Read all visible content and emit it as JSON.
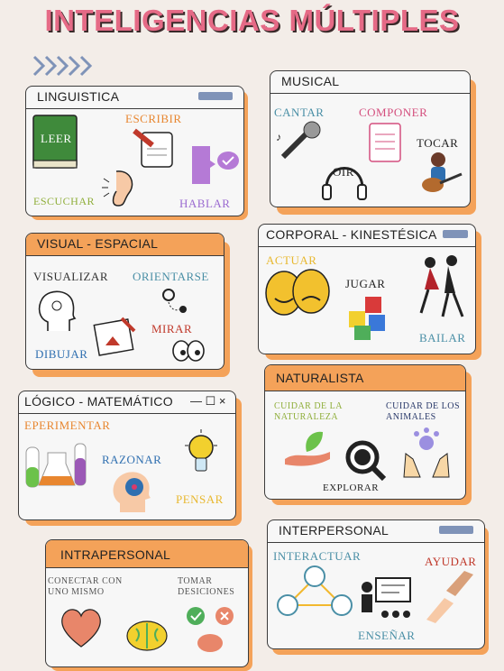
{
  "title": "INTELIGENCIAS MÚLTIPLES",
  "linguistica": {
    "title": "LINGUISTICA",
    "leer": "LEER",
    "escribir": "ESCRIBIR",
    "escuchar": "ESCUCHAR",
    "hablar": "HABLAR"
  },
  "musical": {
    "title": "MUSICAL",
    "cantar": "CANTAR",
    "componer": "COMPONER",
    "tocar": "TOCAR",
    "oir": "OIR"
  },
  "visual": {
    "title": "VISUAL - ESPACIAL",
    "visualizar": "VISUALIZAR",
    "orientarse": "ORIENTARSE",
    "mirar": "MIRAR",
    "dibujar": "DIBUJAR"
  },
  "corporal": {
    "title": "CORPORAL - KINESTÉSICA",
    "actuar": "ACTUAR",
    "jugar": "JUGAR",
    "bailar": "BAILAR"
  },
  "logico": {
    "title": "LÓGICO - MATEMÁTICO",
    "controls": "— ☐ ×",
    "experimentar": "EPERIMENTAR",
    "razonar": "RAZONAR",
    "pensar": "PENSAR"
  },
  "naturalista": {
    "title": "NATURALISTA",
    "cuidar_naturaleza": "CUIDAR DE LA NATURALEZA",
    "cuidar_animales": "CUIDAR DE LOS ANIMALES",
    "explorar": "EXPLORAR"
  },
  "intrapersonal": {
    "title": "INTRAPERSONAL",
    "conectar": "CONECTAR CON UNO MISMO",
    "tomar": "TOMAR DESICIONES"
  },
  "interpersonal": {
    "title": "INTERPERSONAL",
    "interactuar": "INTERACTUAR",
    "ayudar": "AYUDAR",
    "ensenar": "ENSEÑAR"
  },
  "colors": {
    "accent": "#f4a259",
    "title": "#e56a86",
    "bar": "#7f93b8"
  }
}
